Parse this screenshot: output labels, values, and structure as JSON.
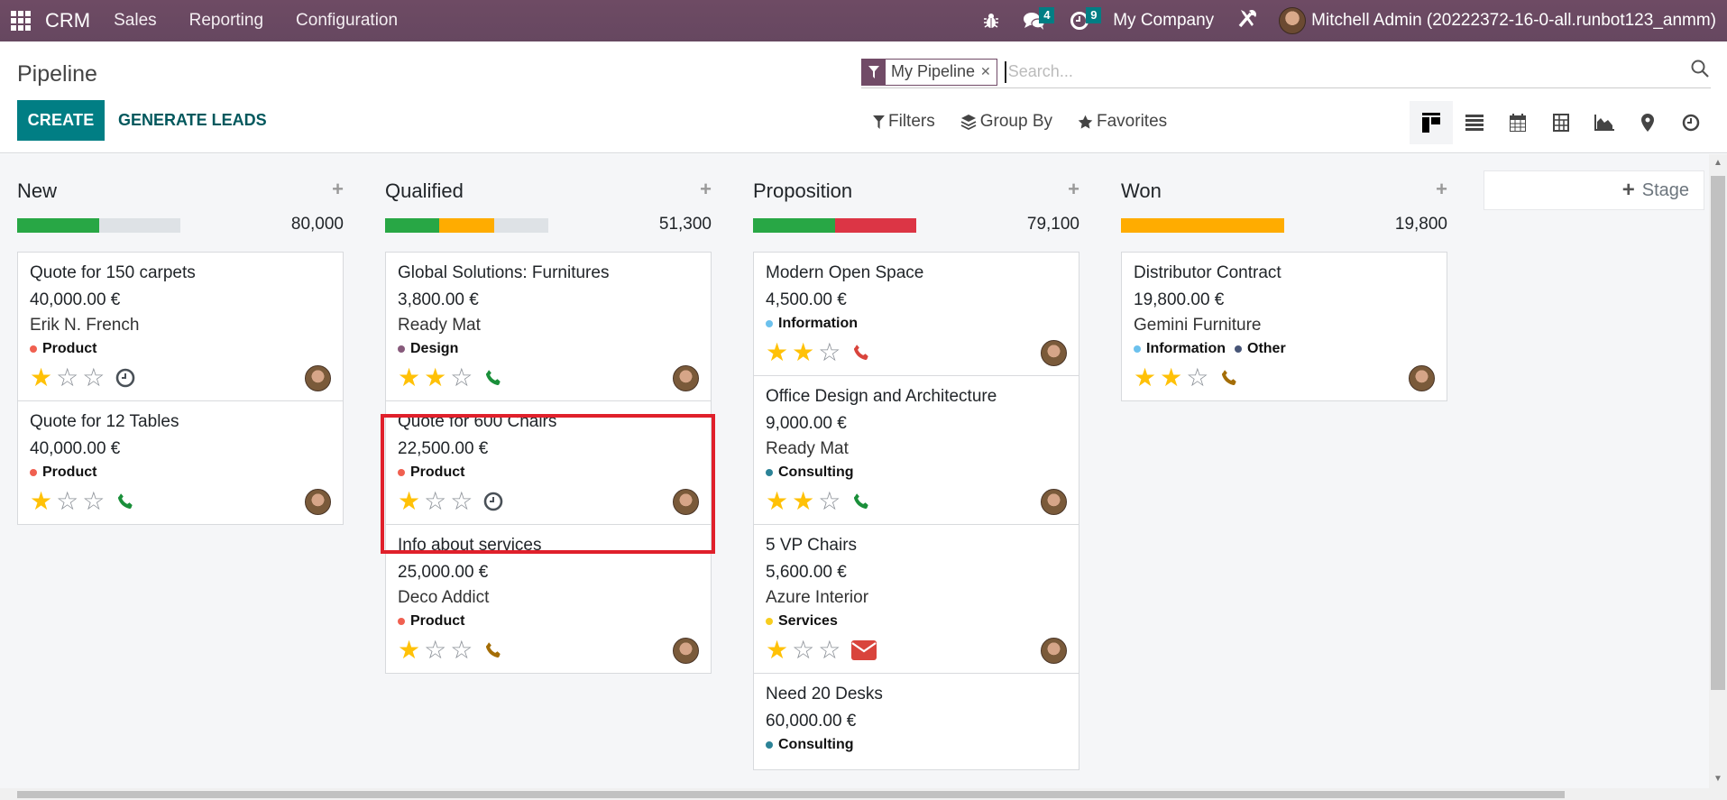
{
  "navbar": {
    "app_name": "CRM",
    "menu": [
      "Sales",
      "Reporting",
      "Configuration"
    ],
    "messages_count": "4",
    "activities_count": "9",
    "company": "My Company",
    "user": "Mitchell Admin (20222372-16-0-all.runbot123_anmm)",
    "colors": {
      "bar": "#714b67",
      "badge": "#017e84"
    }
  },
  "control": {
    "title": "Pipeline",
    "create_label": "CREATE",
    "generate_label": "GENERATE LEADS",
    "facet_label": "My Pipeline",
    "search_placeholder": "Search...",
    "search_value": "",
    "filters_label": "Filters",
    "groupby_label": "Group By",
    "favorites_label": "Favorites",
    "views": [
      "kanban",
      "list",
      "calendar",
      "pivot",
      "graph",
      "map",
      "activity"
    ],
    "active_view": "kanban"
  },
  "kanban": {
    "add_stage_label": "Stage",
    "columns": [
      {
        "title": "New",
        "total": "80,000",
        "progress": [
          {
            "color": "#28a745",
            "fraction": 0.5
          }
        ],
        "cards": [
          {
            "title": "Quote for 150 carpets",
            "amount": "40,000.00 €",
            "partner": "Erik N. French",
            "tags": [
              {
                "label": "Product",
                "color": "#f06050"
              }
            ],
            "stars": 1,
            "activity": "clock"
          },
          {
            "title": "Quote for 12 Tables",
            "amount": "40,000.00 €",
            "partner": "",
            "tags": [
              {
                "label": "Product",
                "color": "#f06050"
              }
            ],
            "stars": 1,
            "activity": "phone-green"
          }
        ]
      },
      {
        "title": "Qualified",
        "total": "51,300",
        "progress": [
          {
            "color": "#28a745",
            "fraction": 0.333
          },
          {
            "color": "#ffac00",
            "fraction": 0.333
          }
        ],
        "cards": [
          {
            "title": "Global Solutions: Furnitures",
            "amount": "3,800.00 €",
            "partner": "Ready Mat",
            "tags": [
              {
                "label": "Design",
                "color": "#875a7b"
              }
            ],
            "stars": 2,
            "activity": "phone-green"
          },
          {
            "title": "Quote for 600 Chairs",
            "amount": "22,500.00 €",
            "partner": "",
            "tags": [
              {
                "label": "Product",
                "color": "#f06050"
              }
            ],
            "stars": 1,
            "activity": "clock"
          },
          {
            "title": "Info about services",
            "amount": "25,000.00 €",
            "partner": "Deco Addict",
            "tags": [
              {
                "label": "Product",
                "color": "#f06050"
              }
            ],
            "stars": 1,
            "activity": "phone-orange"
          }
        ]
      },
      {
        "title": "Proposition",
        "total": "79,100",
        "progress": [
          {
            "color": "#28a745",
            "fraction": 0.5
          },
          {
            "color": "#dc3545",
            "fraction": 0.5
          }
        ],
        "cards": [
          {
            "title": "Modern Open Space",
            "amount": "4,500.00 €",
            "partner": "",
            "tags": [
              {
                "label": "Information",
                "color": "#6cc1ed"
              }
            ],
            "stars": 2,
            "activity": "phone-red"
          },
          {
            "title": "Office Design and Architecture",
            "amount": "9,000.00 €",
            "partner": "Ready Mat",
            "tags": [
              {
                "label": "Consulting",
                "color": "#2c8397"
              }
            ],
            "stars": 2,
            "activity": "phone-green"
          },
          {
            "title": "5 VP Chairs",
            "amount": "5,600.00 €",
            "partner": "Azure Interior",
            "tags": [
              {
                "label": "Services",
                "color": "#f7cd1f"
              }
            ],
            "stars": 1,
            "activity": "envelope-red"
          },
          {
            "title": "Need 20 Desks",
            "amount": "60,000.00 €",
            "partner": "",
            "tags": [
              {
                "label": "Consulting",
                "color": "#2c8397"
              }
            ],
            "stars": 0,
            "activity": ""
          }
        ]
      },
      {
        "title": "Won",
        "total": "19,800",
        "progress": [
          {
            "color": "#ffac00",
            "fraction": 1.0
          }
        ],
        "cards": [
          {
            "title": "Distributor Contract",
            "amount": "19,800.00 €",
            "partner": "Gemini Furniture",
            "tags": [
              {
                "label": "Information",
                "color": "#6cc1ed"
              },
              {
                "label": "Other",
                "color": "#475577"
              }
            ],
            "stars": 2,
            "activity": "phone-orange"
          }
        ]
      }
    ],
    "highlight_color": "#e0202b"
  }
}
